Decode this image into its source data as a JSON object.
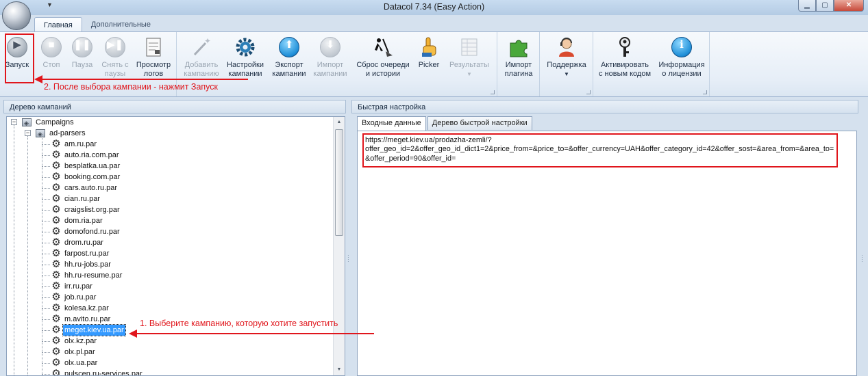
{
  "window": {
    "title": "Datacol 7.34 (Easy Action)",
    "qat_dropdown": "▼",
    "minimize": "▁",
    "maximize": "▢",
    "close": "✕"
  },
  "ribbon_tabs": [
    "Главная",
    "Дополнительные"
  ],
  "ribbon": {
    "run": {
      "line1": "Запуск",
      "icon": "play-icon"
    },
    "stop": {
      "line1": "Стоп",
      "icon": "stop-icon"
    },
    "pause": {
      "line1": "Пауза",
      "icon": "pause-icon"
    },
    "resume": {
      "line1": "Снять с",
      "line2": "паузы",
      "icon": "resume-icon"
    },
    "view_logs": {
      "line1": "Просмотр",
      "line2": "логов",
      "icon": "log-document-icon"
    },
    "add_campaign": {
      "line1": "Добавить",
      "line2": "кампанию",
      "icon": "magic-wand-icon"
    },
    "campaign_settings": {
      "line1": "Настройки",
      "line2": "кампании",
      "icon": "gear-settings-icon"
    },
    "export_campaign": {
      "line1": "Экспорт",
      "line2": "кампании",
      "icon": "export-arrow-up-icon"
    },
    "import_campaign": {
      "line1": "Импорт",
      "line2": "кампании",
      "icon": "import-arrow-down-icon"
    },
    "reset_queue": {
      "line1": "Сброс очереди",
      "line2": "и истории",
      "icon": "broom-icon"
    },
    "picker": {
      "line1": "Picker",
      "icon": "pointing-hand-icon"
    },
    "results": {
      "line1": "Результаты",
      "icon": "table-icon"
    },
    "import_plugin": {
      "line1": "Импорт",
      "line2": "плагина",
      "icon": "puzzle-piece-icon"
    },
    "support": {
      "line1": "Поддержка",
      "icon": "support-agent-icon"
    },
    "activate": {
      "line1": "Активировать",
      "line2": "с новым кодом",
      "icon": "key-icon"
    },
    "license_info": {
      "line1": "Информация",
      "line2": "о лицензии",
      "icon": "info-icon"
    }
  },
  "left_panel": {
    "title": "Дерево кампаний",
    "root": "Campaigns",
    "folder": "ad-parsers",
    "items": [
      "am.ru.par",
      "auto.ria.com.par",
      "besplatka.ua.par",
      "booking.com.par",
      "cars.auto.ru.par",
      "cian.ru.par",
      "craigslist.org.par",
      "dom.ria.par",
      "domofond.ru.par",
      "drom.ru.par",
      "farpost.ru.par",
      "hh.ru-jobs.par",
      "hh.ru-resume.par",
      "irr.ru.par",
      "job.ru.par",
      "kolesa.kz.par",
      "m.avito.ru.par",
      "meget.kiev.ua.par",
      "olx.kz.par",
      "olx.pl.par",
      "olx.ua.par",
      "pulscen.ru-services.par"
    ],
    "selected_index": 17
  },
  "right_panel": {
    "title": "Быстрая настройка",
    "tabs": [
      "Входные данные",
      "Дерево быстрой настройки"
    ],
    "input_text": "https://meget.kiev.ua/prodazha-zemli/?\noffer_geo_id=2&offer_geo_id_dict1=2&price_from=&price_to=&offer_currency=UAH&offer_category_id=42&offer_sost=&area_from=&area_to=&offer_period=90&offer_id="
  },
  "annotations": {
    "step2": "2. После выбора кампании - нажмит Запуск",
    "step1": "1. Выберите кампанию, которую хотите запустить",
    "color": "#e0161c"
  }
}
